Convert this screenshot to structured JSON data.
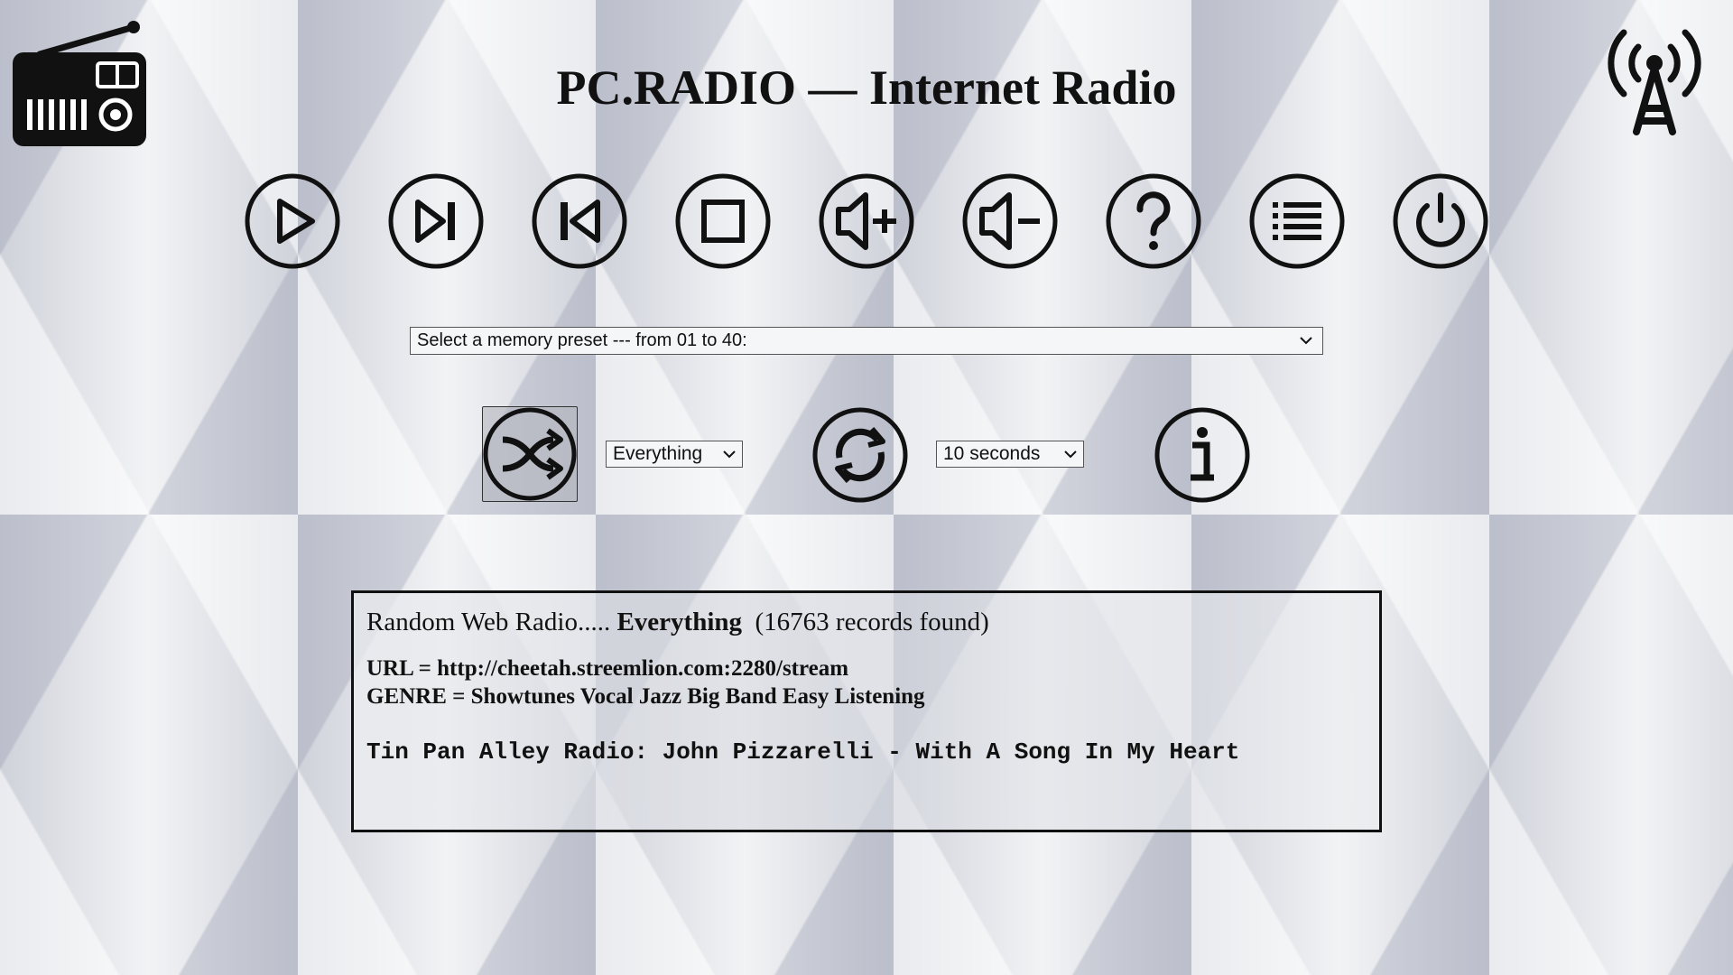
{
  "header": {
    "title": "PC.RADIO — Internet Radio",
    "left_logo_icon": "radio-icon",
    "right_logo_icon": "radio-tower-icon"
  },
  "controls": [
    {
      "name": "play",
      "icon": "play-icon"
    },
    {
      "name": "next",
      "icon": "skip-next-icon"
    },
    {
      "name": "previous",
      "icon": "skip-previous-icon"
    },
    {
      "name": "stop",
      "icon": "stop-icon"
    },
    {
      "name": "volume-up",
      "icon": "volume-up-icon"
    },
    {
      "name": "volume-down",
      "icon": "volume-down-icon"
    },
    {
      "name": "help",
      "icon": "help-icon"
    },
    {
      "name": "list",
      "icon": "list-icon"
    },
    {
      "name": "power",
      "icon": "power-icon"
    }
  ],
  "preset": {
    "selected": "Select a memory preset --- from 01 to 40:"
  },
  "random": {
    "shuffle_icon": "shuffle-icon",
    "genre_selected": "Everything",
    "refresh_icon": "refresh-icon",
    "interval_selected": "10 seconds",
    "info_icon": "info-icon"
  },
  "info_panel": {
    "prefix": "Random Web Radio.....",
    "genre": "Everything",
    "count": "(16763 records found)",
    "url_line": "URL = http://cheetah.streemlion.com:2280/stream",
    "genre_line": "GENRE = Showtunes Vocal Jazz Big Band Easy Listening",
    "now_playing": "Tin Pan Alley Radio: John Pizzarelli - With A Song In My Heart"
  },
  "colors": {
    "icon_stroke": "#111111",
    "panel_border": "#111111"
  }
}
